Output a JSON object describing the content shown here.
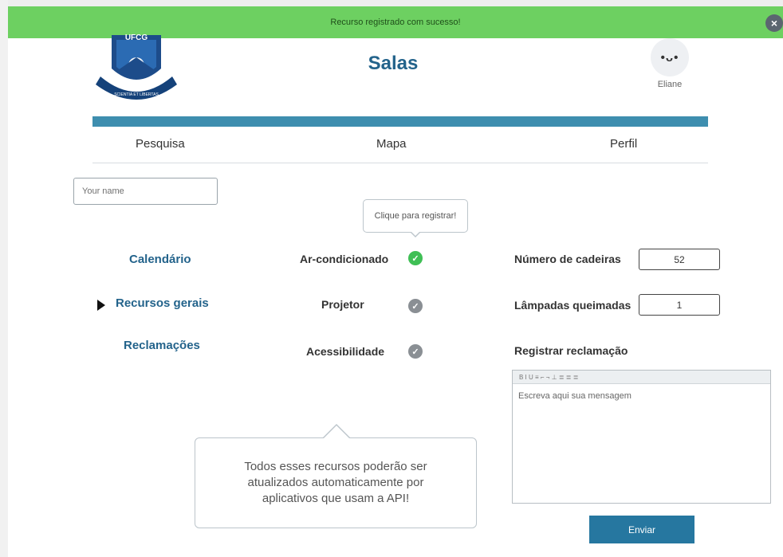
{
  "toast": {
    "message": "Recurso registrado com sucesso!",
    "close_icon": "×"
  },
  "logo": {
    "text": "UFCG",
    "motto": "SCIENTIA ET LIBERTAS"
  },
  "header": {
    "title": "Salas",
    "avatar_face": "•ᴗ•",
    "user_name": "Eliane"
  },
  "nav": {
    "pesquisa": "Pesquisa",
    "mapa": "Mapa",
    "perfil": "Perfil"
  },
  "name_input": {
    "placeholder": "Your name",
    "value": ""
  },
  "tooltip_small": "Clique para registrar!",
  "side_menu": {
    "calendario": "Calendário",
    "recursos": "Recursos gerais",
    "reclamacoes": "Reclamações"
  },
  "resources": [
    {
      "label": "Ar-condicionado",
      "active": true
    },
    {
      "label": "Projetor",
      "active": false
    },
    {
      "label": "Acessibilidade",
      "active": false
    }
  ],
  "fields": {
    "cadeiras_label": "Número de cadeiras",
    "cadeiras_value": "52",
    "lampadas_label": "Lâmpadas queimadas",
    "lampadas_value": "1"
  },
  "reclamacao": {
    "label": "Registrar reclamação",
    "toolbar": "B I U ≡ ⌐ ¬ ⊥ ≣ ≣ ≣",
    "placeholder": "Escreva aqui sua mensagem"
  },
  "tooltip_big": "Todos esses recursos poderão ser atualizados automaticamente por aplicativos que usam a API!",
  "send_button": "Enviar",
  "colors": {
    "toast_bg": "#6dd061",
    "primary": "#23638b",
    "header_bar": "#3e8eaf",
    "check_on": "#3fbf55",
    "check_off": "#8a8f94",
    "button": "#2677a0"
  }
}
